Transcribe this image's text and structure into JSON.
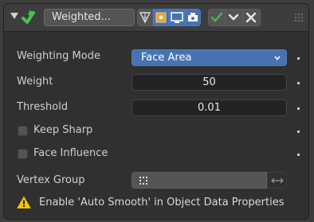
{
  "modifier": {
    "name": "Weighted...",
    "apply_icon": "checkmark-icon",
    "menu_icon": "chevron-down-icon",
    "close_icon": "close-icon"
  },
  "rows": {
    "weighting_mode": {
      "label": "Weighting Mode",
      "value": "Face Area"
    },
    "weight": {
      "label": "Weight",
      "value": "50"
    },
    "threshold": {
      "label": "Threshold",
      "value": "0.01"
    },
    "keep_sharp": {
      "label": "Keep Sharp",
      "checked": false
    },
    "face_influence": {
      "label": "Face Influence",
      "checked": false
    },
    "vertex_group": {
      "label": "Vertex Group",
      "value": "",
      "invert_icon": "swap-arrows-icon"
    }
  },
  "warning": {
    "text": "Enable 'Auto Smooth' in Object Data Properties"
  },
  "colors": {
    "accent": "#4772b3",
    "apply_green": "#4caf50",
    "warning": "#f5c400"
  }
}
